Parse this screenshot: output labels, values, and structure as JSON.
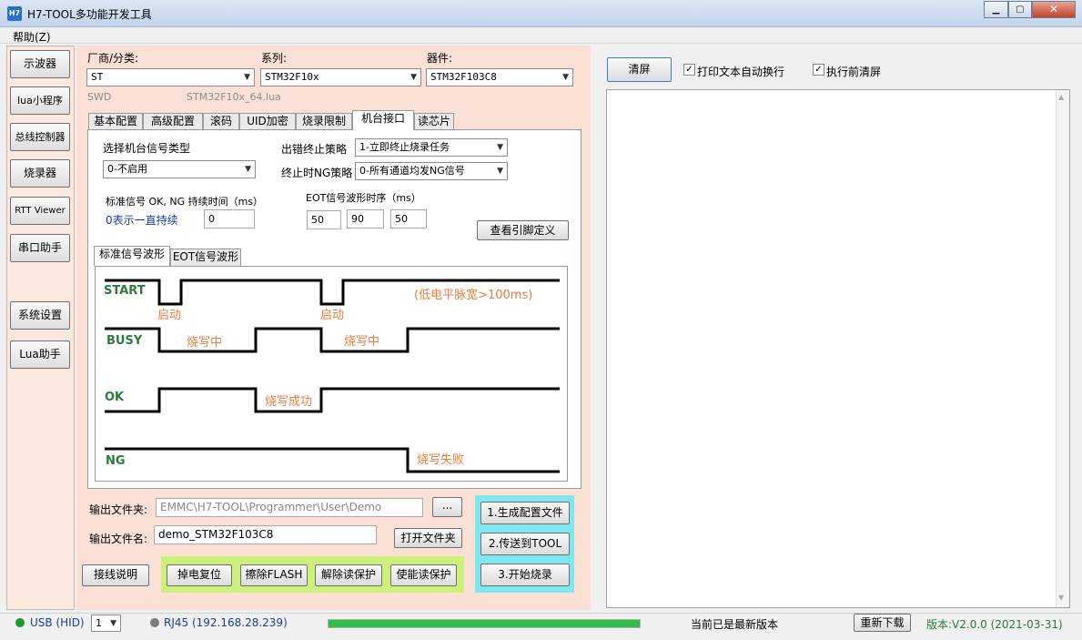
{
  "window": {
    "title": "H7-TOOL多功能开发工具",
    "icon": "H7",
    "min": "▁",
    "max": "▢",
    "close": "✕"
  },
  "menu": {
    "help": "帮助(Z)"
  },
  "sidebar": {
    "items": [
      "示波器",
      "lua小程序",
      "总线控制器",
      "烧录器",
      "RTT Viewer",
      "串口助手",
      "系统设置",
      "Lua助手"
    ]
  },
  "selectors": {
    "vendor_label": "厂商/分类:",
    "vendor": "ST",
    "series_label": "系列:",
    "series": "STM32F10x",
    "device_label": "器件:",
    "device": "STM32F103C8",
    "interface": "SWD",
    "lua_file": "STM32F10x_64.lua"
  },
  "tabs": [
    "基本配置",
    "高级配置",
    "滚码",
    "UID加密",
    "烧录限制",
    "机台接口",
    "读芯片"
  ],
  "machine": {
    "signal_type_label": "选择机台信号类型",
    "signal_type": "0-不启用",
    "error_policy_label": "出错终止策略",
    "error_policy": "1-立即终止烧录任务",
    "ng_policy_label": "终止时NG策略",
    "ng_policy": "0-所有通道均发NG信号",
    "std_time_label": "标准信号 OK, NG 持续时间（ms）",
    "hold_hint": "0表示一直持续",
    "std_time": "0",
    "eot_label": "EOT信号波形时序（ms）",
    "eot1": "50",
    "eot2": "90",
    "eot3": "50",
    "pin_button": "查看引脚定义"
  },
  "wave_tabs": [
    "标准信号波形",
    "EOT信号波形"
  ],
  "wave": {
    "start": "START",
    "busy": "BUSY",
    "ok": "OK",
    "ng": "NG",
    "start_note": "启动",
    "start_note2": "启动",
    "pulse_note": "(低电平脉宽>100ms)",
    "writing": "烧写中",
    "writing2": "烧写中",
    "success": "烧写成功",
    "fail": "烧写失败"
  },
  "output": {
    "folder_label": "输出文件夹:",
    "folder": "EMMC\\H7-TOOL\\Programmer\\User\\Demo",
    "browse": "...",
    "file_label": "输出文件名:",
    "file": "demo_STM32F103C8",
    "open_folder": "打开文件夹"
  },
  "actions": {
    "gen": "1.生成配置文件",
    "send": "2.传送到TOOL",
    "start": "3.开始烧录",
    "wiring": "接线说明",
    "power_reset": "掉电复位",
    "erase": "擦除FLASH",
    "unprotect": "解除读保护",
    "protect": "使能读保护"
  },
  "log": {
    "clear": "清屏",
    "wrap_label": "打印文本自动换行",
    "clear_before": "执行前清屏"
  },
  "status": {
    "usb": "USB (HID)",
    "channel": "1",
    "rj45": "RJ45 (192.168.28.239)",
    "progress": 1.0,
    "latest": "当前已是最新版本",
    "redownload": "重新下载",
    "version": "版本:V2.0.0 (2021-03-31)"
  },
  "colors": {
    "accent_green": "#2a7a3a",
    "note_orange": "#f07a3c",
    "panel_pink": "#fbe0d6",
    "highlight_cyan": "#7fe7f0",
    "highlight_lime": "#ccf07a",
    "progress_green": "#2dbd4b"
  }
}
